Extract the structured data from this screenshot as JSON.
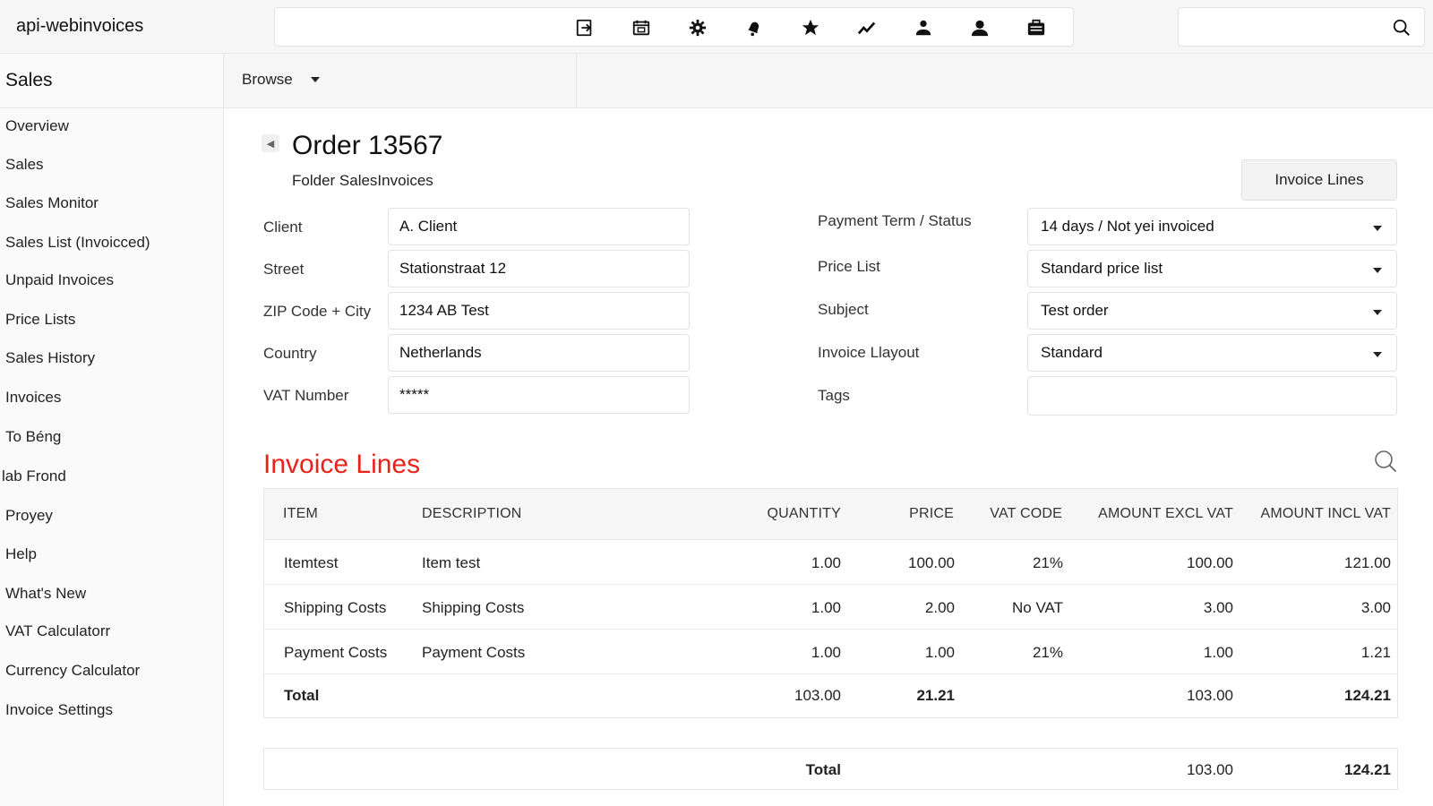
{
  "app": {
    "title": "api-webinvoices"
  },
  "toolbar": {
    "icons": [
      "import-icon",
      "calendar-icon",
      "gear-icon",
      "bell-icon",
      "star-icon",
      "chart-icon",
      "user-icon",
      "profile-icon",
      "briefcase-icon"
    ]
  },
  "search": {
    "placeholder": "",
    "value": ""
  },
  "sidebar": {
    "title": "Sales",
    "items": [
      {
        "label": "Overview"
      },
      {
        "label": "Sales"
      },
      {
        "label": "Sales Monitor"
      },
      {
        "label": "Sales List (Invoicced)"
      },
      {
        "label": "Unpaid Invoices"
      },
      {
        "label": "Price Lists"
      },
      {
        "label": "Sales History"
      },
      {
        "label": "Invoices"
      },
      {
        "label": "To Béng"
      },
      {
        "label": "lab Frond"
      },
      {
        "label": "Proyey"
      },
      {
        "label": "Help"
      },
      {
        "label": "What's New"
      },
      {
        "label": "VAT Calculatorr"
      },
      {
        "label": "Currency Calculator"
      },
      {
        "label": "Invoice Settings"
      }
    ]
  },
  "subheader": {
    "browse_label": "Browse"
  },
  "order": {
    "title": "Order 13567",
    "folder": "Folder SalesInvoices",
    "invoice_lines_button": "Invoice Lines"
  },
  "form": {
    "client": {
      "label": "Client",
      "value": "A. Client"
    },
    "street": {
      "label": "Street",
      "value": "Stationstraat 12"
    },
    "zip_city": {
      "label": "ZIP Code + City",
      "value": "1234 AB Test"
    },
    "country": {
      "label": "Country",
      "value": "Netherlands"
    },
    "vat_number": {
      "label": "VAT Number",
      "value": "*****"
    },
    "payment_term": {
      "label": "Payment Term / Status",
      "value": "14 days / Not yei invoiced"
    },
    "price_list": {
      "label": "Price List",
      "value": "Standard price list"
    },
    "subject": {
      "label": "Subject",
      "value": "Test order"
    },
    "invoice_layout": {
      "label": "Invoice Llayout",
      "value": "Standard"
    },
    "tags": {
      "label": "Tags",
      "value": ""
    }
  },
  "invoice_lines": {
    "title": "Invoice Lines",
    "headers": {
      "item": "ITEM",
      "description": "DESCRIPTION",
      "quantity": "QUANTITY",
      "price": "PRICE",
      "vat_code": "VAT CODE",
      "amount_excl": "AMOUNT EXCL VAT",
      "amount_incl": "AMOUNT INCL VAT"
    },
    "rows": [
      {
        "item": "Itemtest",
        "description": "Item test",
        "quantity": "1.00",
        "price": "100.00",
        "vat_code": "21%",
        "amount_excl": "100.00",
        "amount_incl": "121.00"
      },
      {
        "item": "Shipping Costs",
        "description": "Shipping Costs",
        "quantity": "1.00",
        "price": "2.00",
        "vat_code": "No VAT",
        "amount_excl": "3.00",
        "amount_incl": "3.00"
      },
      {
        "item": "Payment Costs",
        "description": "Payment Costs",
        "quantity": "1.00",
        "price": "1.00",
        "vat_code": "21%",
        "amount_excl": "1.00",
        "amount_incl": "1.21"
      }
    ],
    "total_row": {
      "label": "Total",
      "quantity": "103.00",
      "price": "21.21",
      "amount_excl": "103.00",
      "amount_incl": "124.21"
    }
  },
  "grand_total": {
    "label": "Total",
    "amount_excl": "103.00",
    "amount_incl": "124.21"
  }
}
